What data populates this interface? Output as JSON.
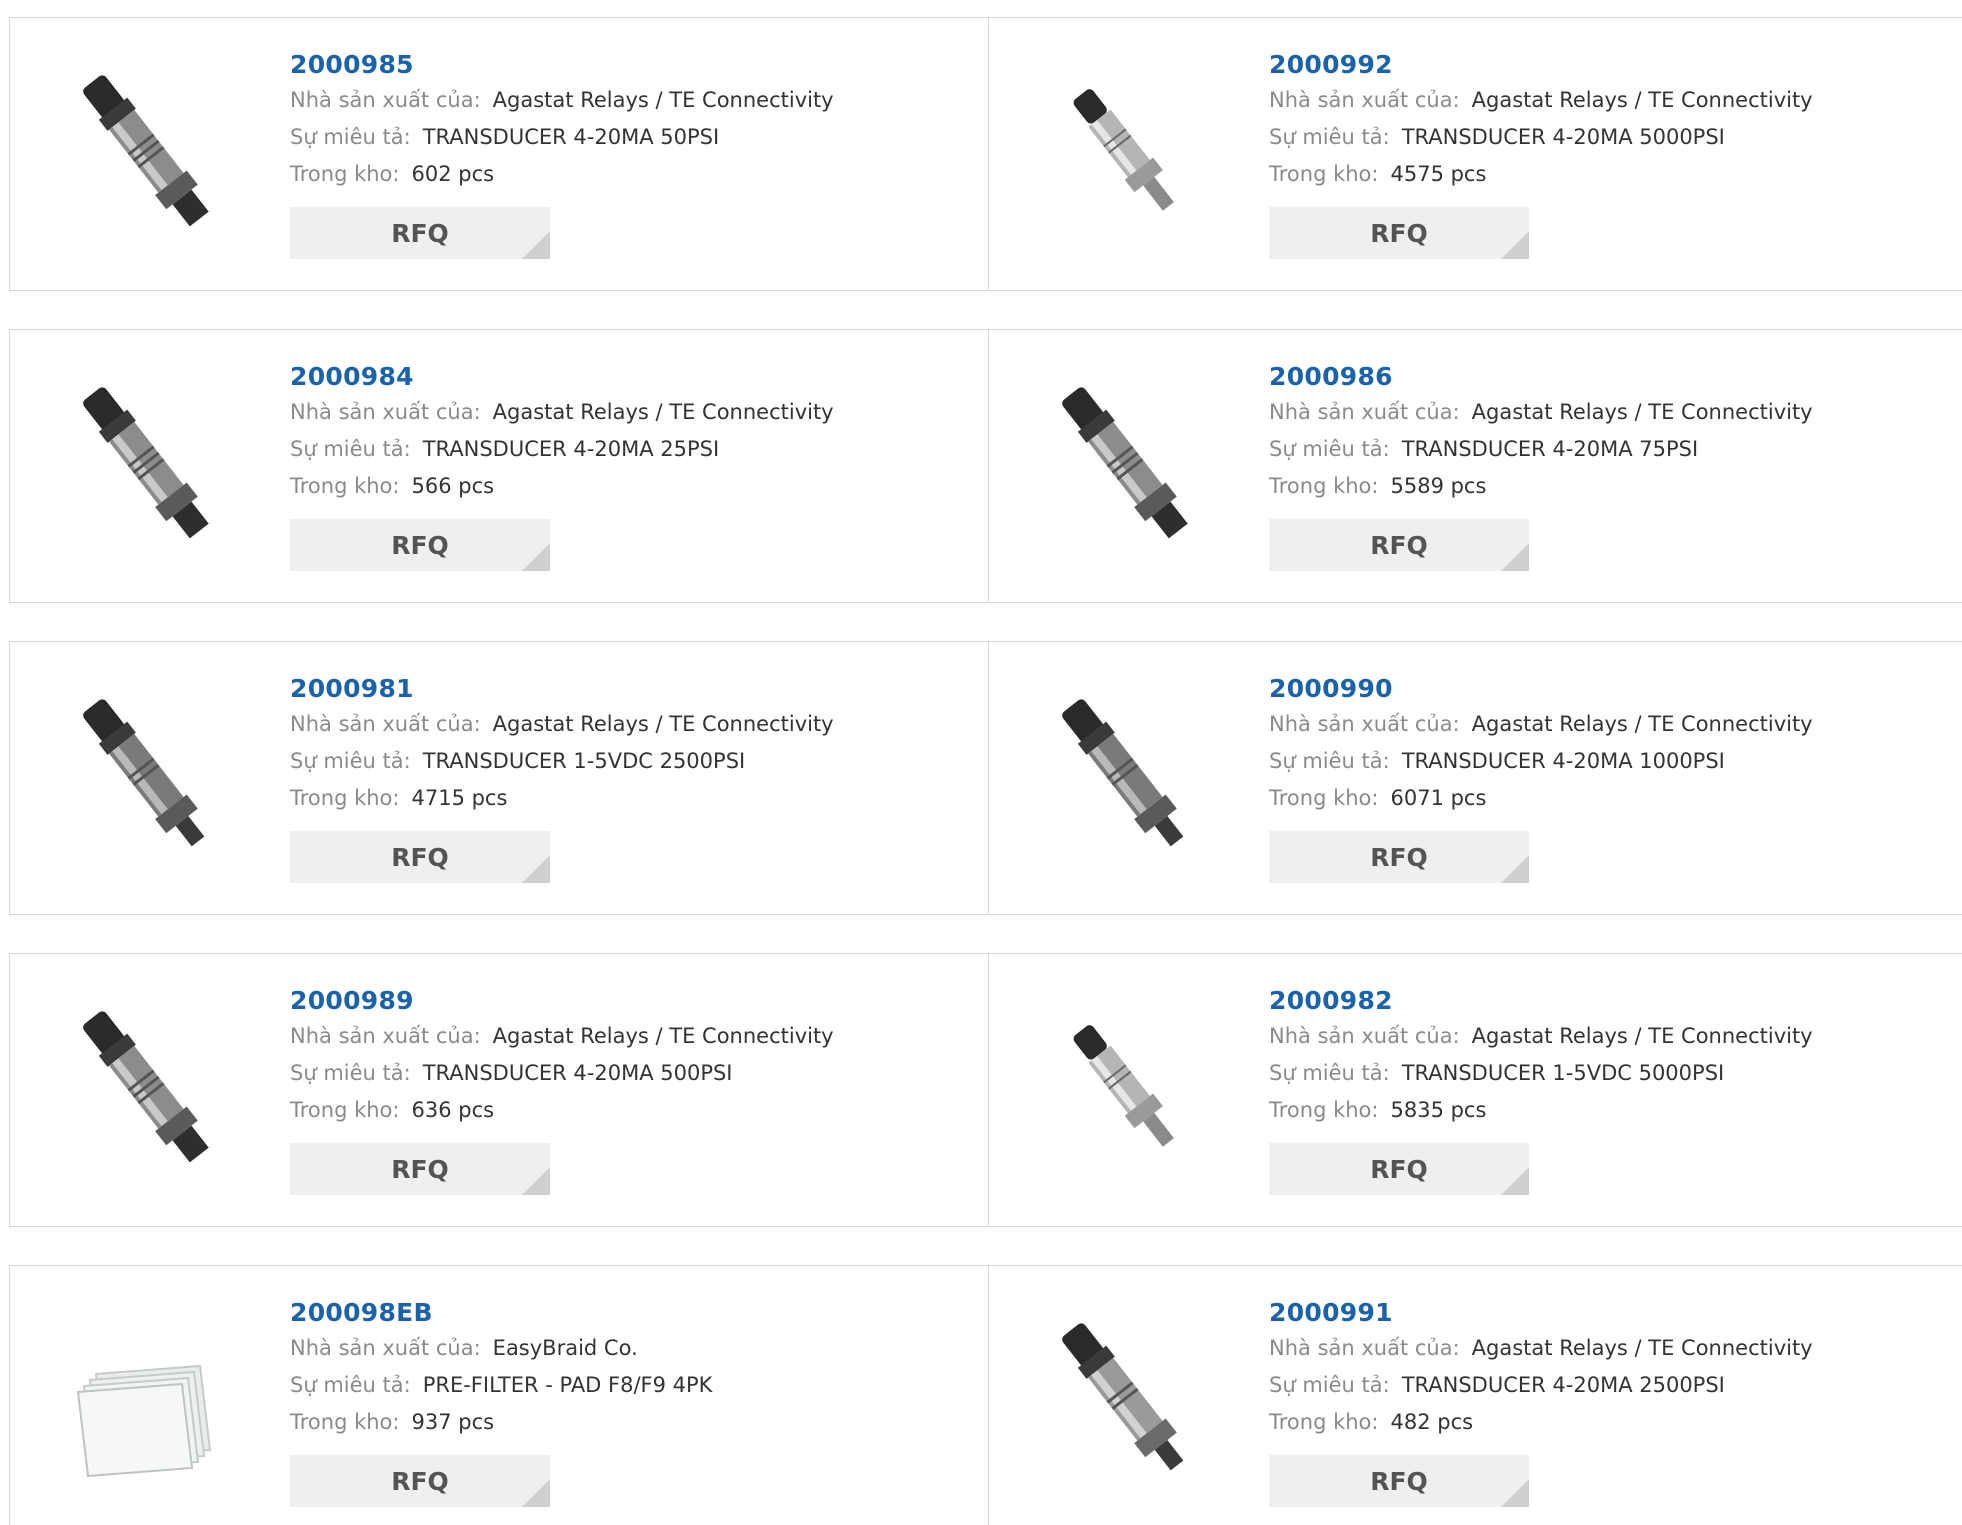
{
  "labels": {
    "manufacturer": "Nhà sản xuất của:",
    "description": "Sự miêu tả:",
    "stock": "Trong kho:",
    "rfq": "RFQ"
  },
  "products": [
    {
      "part": "2000985",
      "manufacturer": "Agastat Relays / TE Connectivity",
      "description": "TRANSDUCER 4-20MA 50PSI",
      "stock": "602 pcs",
      "image": "pressure-transducer-icon"
    },
    {
      "part": "2000992",
      "manufacturer": "Agastat Relays / TE Connectivity",
      "description": "TRANSDUCER 4-20MA 5000PSI",
      "stock": "4575 pcs",
      "image": "pressure-transducer-icon"
    },
    {
      "part": "2000984",
      "manufacturer": "Agastat Relays / TE Connectivity",
      "description": "TRANSDUCER 4-20MA 25PSI",
      "stock": "566 pcs",
      "image": "pressure-transducer-icon"
    },
    {
      "part": "2000986",
      "manufacturer": "Agastat Relays / TE Connectivity",
      "description": "TRANSDUCER 4-20MA 75PSI",
      "stock": "5589 pcs",
      "image": "pressure-transducer-icon"
    },
    {
      "part": "2000981",
      "manufacturer": "Agastat Relays / TE Connectivity",
      "description": "TRANSDUCER 1-5VDC 2500PSI",
      "stock": "4715 pcs",
      "image": "pressure-transducer-icon"
    },
    {
      "part": "2000990",
      "manufacturer": "Agastat Relays / TE Connectivity",
      "description": "TRANSDUCER 4-20MA 1000PSI",
      "stock": "6071 pcs",
      "image": "pressure-transducer-icon"
    },
    {
      "part": "2000989",
      "manufacturer": "Agastat Relays / TE Connectivity",
      "description": "TRANSDUCER 4-20MA 500PSI",
      "stock": "636 pcs",
      "image": "pressure-transducer-icon"
    },
    {
      "part": "2000982",
      "manufacturer": "Agastat Relays / TE Connectivity",
      "description": "TRANSDUCER 1-5VDC 5000PSI",
      "stock": "5835 pcs",
      "image": "pressure-transducer-icon"
    },
    {
      "part": "200098EB",
      "manufacturer": "EasyBraid Co.",
      "description": "PRE-FILTER - PAD F8/F9 4PK",
      "stock": "937 pcs",
      "image": "filter-pad-icon"
    },
    {
      "part": "2000991",
      "manufacturer": "Agastat Relays / TE Connectivity",
      "description": "TRANSDUCER 4-20MA 2500PSI",
      "stock": "482 pcs",
      "image": "pressure-transducer-icon"
    }
  ],
  "colors": {
    "part_link": "#1b62ad",
    "label": "#8a8a8a",
    "value": "#333333",
    "rfq_bg": "#efefef",
    "rfq_corner": "#cfcfcf",
    "border": "#d6d6d6"
  }
}
